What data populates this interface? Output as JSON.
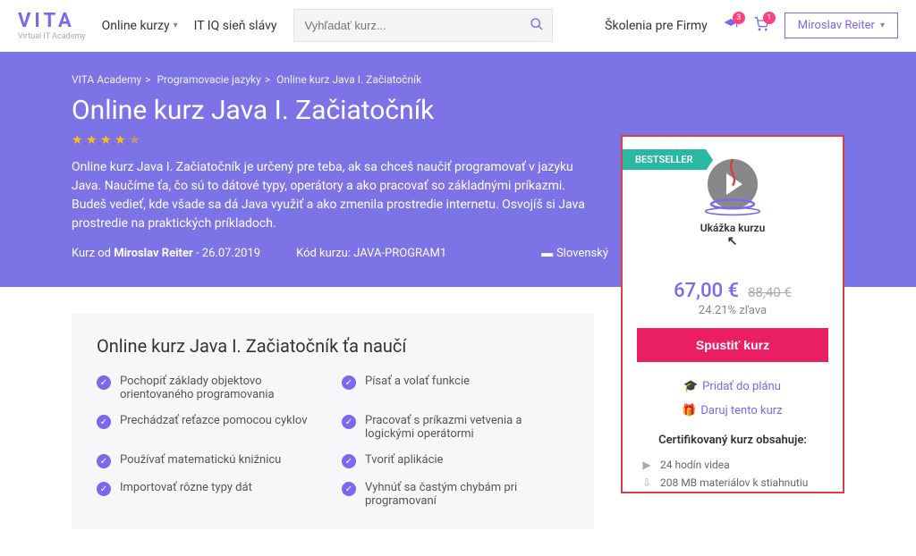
{
  "header": {
    "logo": "VITA",
    "logo_sub": "Virtual IT Academy",
    "nav_courses": "Online kurzy",
    "nav_hall": "IT IQ sieň slávy",
    "search_placeholder": "Vyhľadať kurz...",
    "nav_companies": "Školenia pre Firmy",
    "badge_grad": "3",
    "badge_cart": "1",
    "user": "Miroslav Reiter"
  },
  "crumbs": [
    "VITA Academy",
    "Programovacie jazyky",
    "Online kurz Java I. Začiatočník"
  ],
  "hero": {
    "title": "Online kurz Java I. Začiatočník",
    "desc": "Online kurz Java I. Začiatočník je určený pre teba, ak sa chceš naučiť programovať v jazyku Java. Naučíme ťa, čo sú to dátové typy, operátory a ako pracovať so základnými príkazmi. Budeš vedieť, kde všade sa dá Java využiť a ako zmenila prostredie internetu. Osvojíš si Java prostredie na praktických príkladoch.",
    "author_prefix": "Kurz od ",
    "author": "Miroslav Reiter",
    "date": " - 26.07.2019",
    "code_label": "Kód kurzu: JAVA-PROGRAM1",
    "lang": "Slovenský"
  },
  "learn": {
    "title": "Online kurz Java I. Začiatočník ťa naučí",
    "items": [
      "Pochopiť základy objektovo orientovaného programovania",
      "Písať a volať funkcie",
      "Prechádzať reťazce pomocou cyklov",
      "Pracovať s príkazmi vetvenia a logickými operátormi",
      "Používať matematickú knižnicu",
      "Tvoriť aplikácie",
      "Importovať rôzne typy dát",
      "Vyhnúť sa častým chybám pri programovaní"
    ]
  },
  "sidebar": {
    "bestseller": "BESTSELLER",
    "preview": "Ukážka kurzu",
    "price": "67,00 €",
    "old_price": "88,40 €",
    "discount": "24.21% zľava",
    "cta": "Spustiť kurz",
    "add_plan": "Pridať do plánu",
    "gift": "Daruj tento kurz",
    "cert_title": "Certifikovaný kurz obsahuje:",
    "hours": "24 hodín videa",
    "materials": "208 MB materiálov k stiahnutiu"
  }
}
